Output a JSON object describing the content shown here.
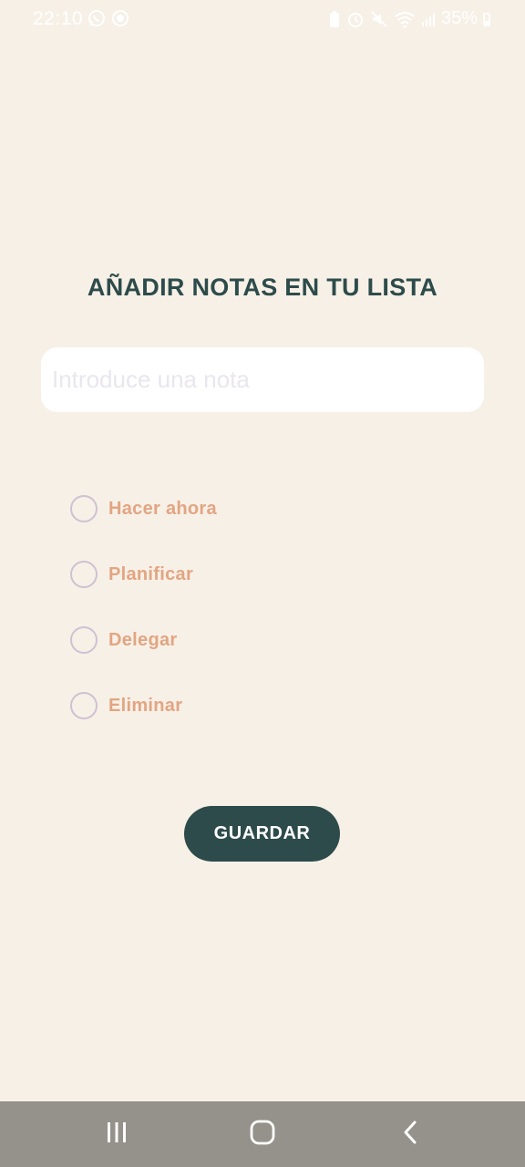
{
  "status_bar": {
    "time": "22:10",
    "battery": "35%",
    "left_icons": [
      "whatsapp-icon",
      "record-icon"
    ],
    "right_icons": [
      "battery-saver-icon",
      "alarm-icon",
      "mute-icon",
      "wifi-icon",
      "signal-icon",
      "battery-icon"
    ]
  },
  "page": {
    "title": "AÑADIR NOTAS EN TU LISTA"
  },
  "note_input": {
    "placeholder": "Introduce una nota",
    "value": ""
  },
  "options": [
    {
      "label": "Hacer ahora",
      "selected": false
    },
    {
      "label": "Planificar",
      "selected": false
    },
    {
      "label": "Delegar",
      "selected": false
    },
    {
      "label": "Eliminar",
      "selected": false
    }
  ],
  "save_button": {
    "label": "GUARDAR"
  },
  "nav_bar": {
    "buttons": [
      "recent-apps-icon",
      "home-icon",
      "back-icon"
    ]
  },
  "colors": {
    "background": "#f7f0e6",
    "primary": "#2d4b4b",
    "option_label": "#e2a583",
    "radio_border": "#cfc1d3",
    "nav_bar": "#95918b"
  }
}
